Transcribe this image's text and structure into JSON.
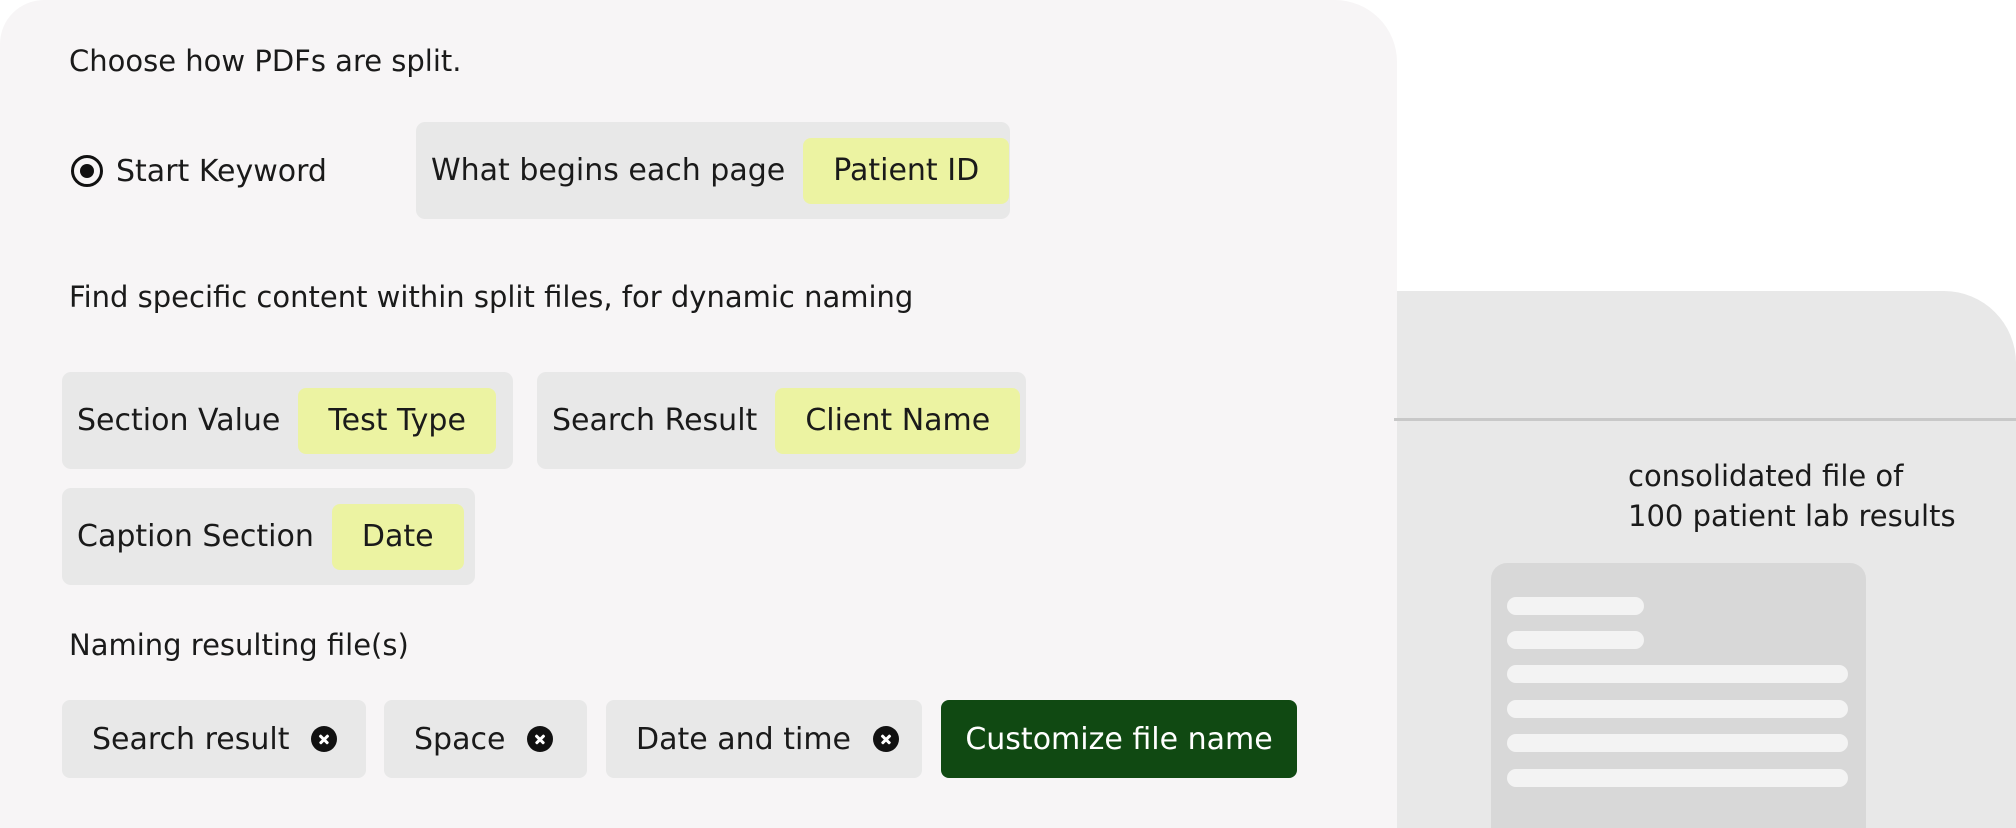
{
  "split": {
    "prompt": "Choose how PDFs are split.",
    "option_label": "Start Keyword",
    "option_selected": true,
    "field_label": "What begins each page",
    "field_value": "Patient ID"
  },
  "dynamic": {
    "prompt": "Find specific content within split files, for dynamic naming",
    "items": [
      {
        "label": "Section Value",
        "value": "Test Type"
      },
      {
        "label": "Search Result",
        "value": "Client Name"
      },
      {
        "label": "Caption Section",
        "value": "Date"
      }
    ]
  },
  "naming": {
    "prompt": "Naming resulting file(s)",
    "tags": [
      "Search result",
      "Space",
      "Date and time"
    ],
    "customize_label": "Customize file name"
  },
  "preview": {
    "caption_line1": "consolidated file of",
    "caption_line2": "100 patient lab results"
  },
  "colors": {
    "panel_bg": "#f7f5f6",
    "chip_bg": "#e8e8e8",
    "highlight": "#ecf3a2",
    "primary_button": "#104912"
  },
  "icons": {
    "radio": "radio-selected-icon",
    "remove": "remove-circle-x-icon",
    "document": "document-icon"
  }
}
